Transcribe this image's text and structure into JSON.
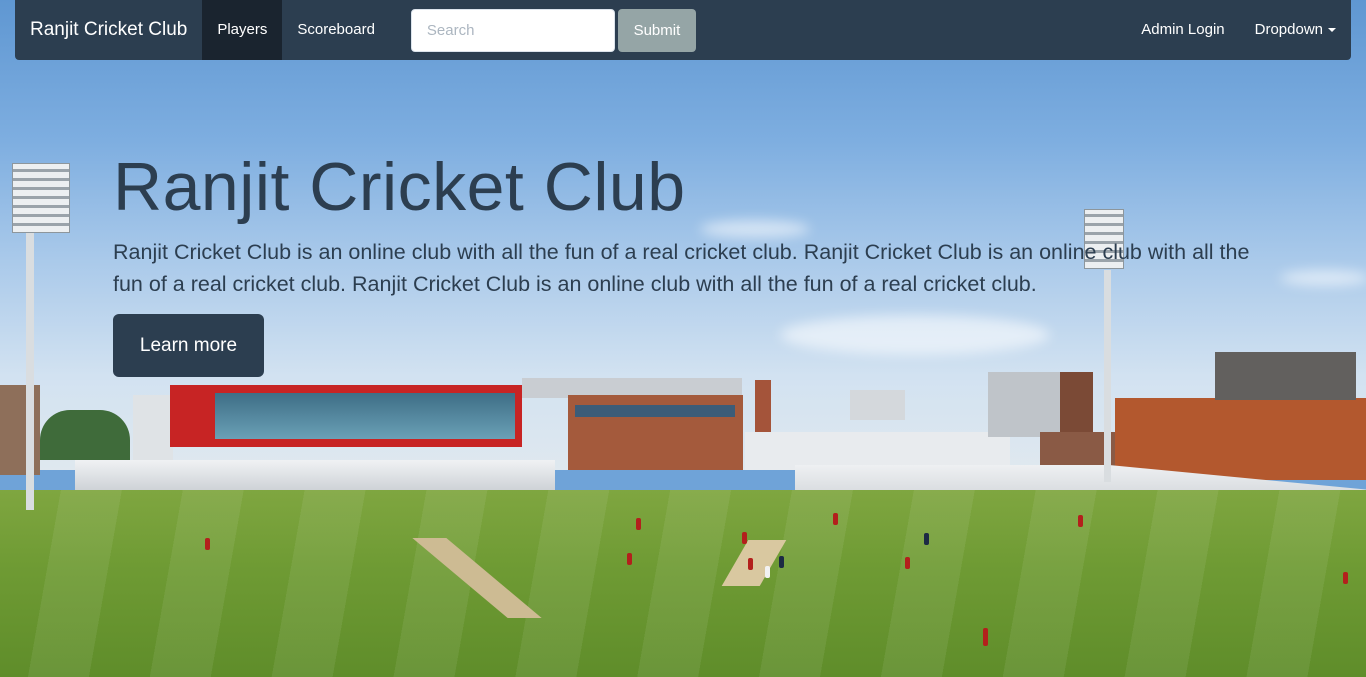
{
  "navbar": {
    "brand": "Ranjit Cricket Club",
    "links": [
      "Players",
      "Scoreboard"
    ],
    "active_link": "Players",
    "search": {
      "placeholder": "Search",
      "value": ""
    },
    "submit_label": "Submit",
    "right_links": {
      "admin_login": "Admin Login",
      "dropdown": "Dropdown"
    }
  },
  "hero": {
    "title": "Ranjit Cricket Club",
    "text": "Ranjit Cricket Club is an online club with all the fun of a real cricket club. Ranjit Cricket Club is an online club with all the fun of a real cricket club. Ranjit Cricket Club is an online club with all the fun of a real cricket club.",
    "button_label": "Learn more"
  },
  "colors": {
    "navbar": "#2c3e50",
    "navbar_active": "#1a242f",
    "submit": "#95a5a6",
    "primary_text": "#2c3e50"
  },
  "background": {
    "subject": "cricket-stadium-photo"
  }
}
